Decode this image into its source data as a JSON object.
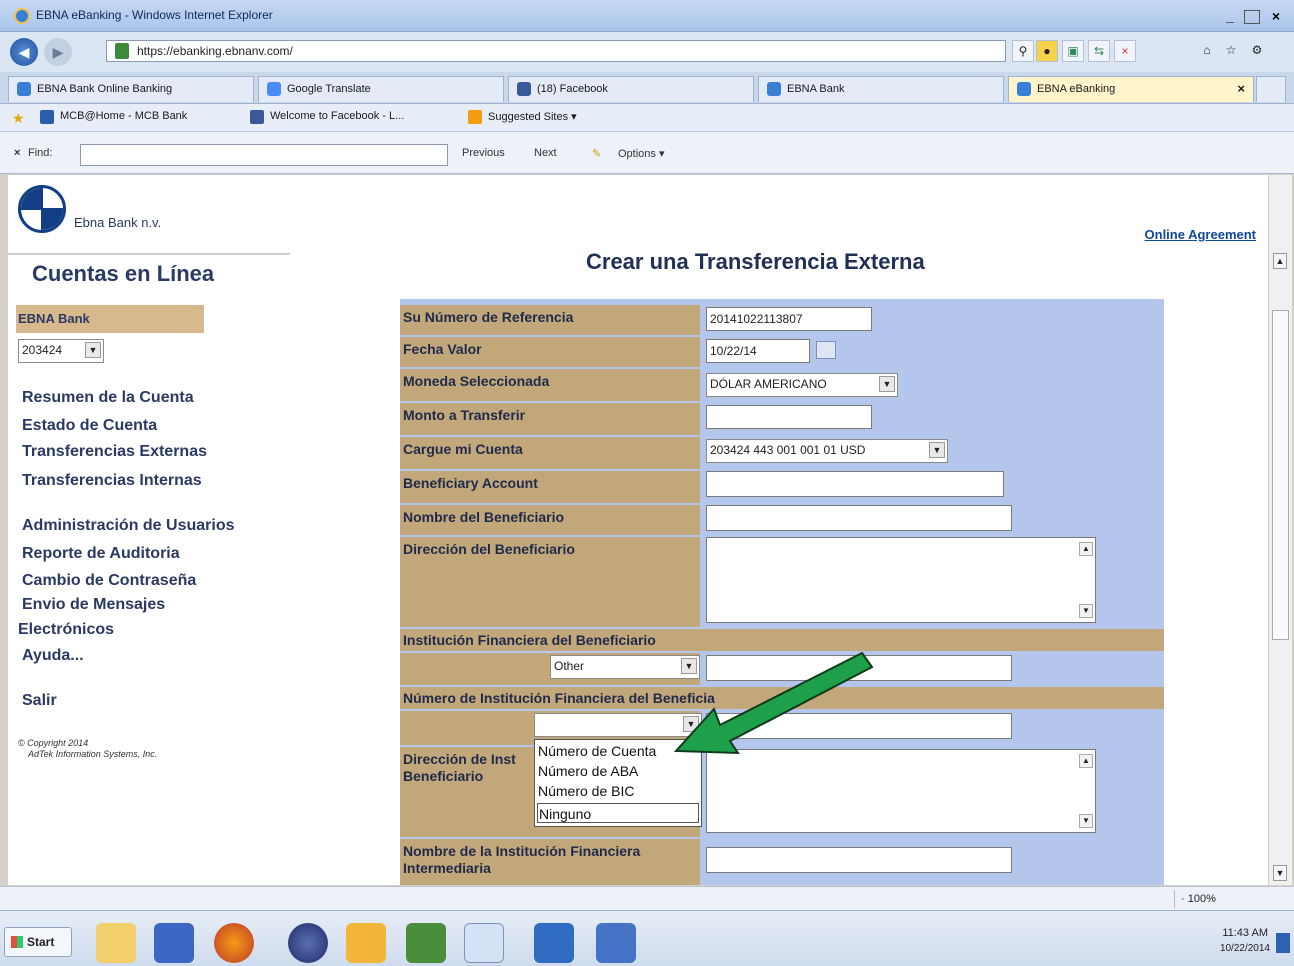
{
  "window": {
    "title": "EBNA eBanking - Windows Internet Explorer",
    "minimize": "_",
    "maximize": " ",
    "close": "×"
  },
  "address": {
    "url": "https://ebanking.ebnanv.com/"
  },
  "tabs": [
    {
      "label": "EBNA Bank Online Banking"
    },
    {
      "label": "Google Translate"
    },
    {
      "label": "(18) Facebook"
    },
    {
      "label": "EBNA Bank"
    },
    {
      "label": "EBNA eBanking",
      "close": "×"
    }
  ],
  "favorites": [
    {
      "label": "MCB@Home - MCB Bank"
    },
    {
      "label": "Welcome to Facebook - L..."
    },
    {
      "label": "Suggested Sites ▾"
    }
  ],
  "findbar": {
    "close": "×",
    "label": "Find:",
    "previous": "Previous",
    "next": "Next",
    "options": "Options ▾"
  },
  "header": {
    "bank_name": "Ebna Bank n.v.",
    "online_agreement": "Online Agreement"
  },
  "sidebar": {
    "title": "Cuentas en Línea",
    "bank_bar": "EBNA Bank",
    "account_select": "203424",
    "links": [
      "Resumen de la Cuenta",
      "Estado de Cuenta",
      "Transferencias Externas",
      "Transferencias Internas",
      "Administración de Usuarios",
      "Reporte de Auditoria",
      "Cambio de Contraseña",
      "Envio de Mensajes",
      "Electrónicos",
      "Ayuda...",
      "Salir"
    ],
    "copyright_line1": "© Copyright 2014",
    "copyright_line2": "AdTek Information Systems, Inc."
  },
  "form": {
    "heading": "Crear una Transferencia Externa",
    "labels": {
      "reference": "Su Número de Referencia",
      "value_date": "Fecha Valor",
      "currency": "Moneda Seleccionada",
      "amount": "Monto a Transferir",
      "debit_account": "Cargue mi Cuenta",
      "beneficiary_account": "Beneficiary Account",
      "beneficiary_name": "Nombre del Beneficiario",
      "beneficiary_address": "Dirección del Beneficiario",
      "fi_section": "Institución Financiera del Beneficiario",
      "fi_number": "Número de Institución Financiera del Beneficia",
      "fi_address_1": "Dirección de Inst",
      "fi_address_2": "Beneficiario",
      "intermediary_1": "Nombre de la Institución Financiera",
      "intermediary_2": "Intermediaria"
    },
    "values": {
      "reference": "20141022113807",
      "value_date": "10/22/14",
      "currency": "DÓLAR AMERICANO",
      "amount": "",
      "debit_account": "203424 443 001 001 01 USD",
      "beneficiary_account": "",
      "beneficiary_name": "",
      "fi_type": "Other",
      "fi_number_type": ""
    },
    "dropdown_options": [
      "Número de Cuenta",
      "Número de ABA",
      "Número de BIC",
      "Ninguno"
    ]
  },
  "statusbar": {
    "zoom": "· 100%"
  },
  "taskbar": {
    "start": "Start",
    "time": "11:43 AM",
    "date": "10/22/2014"
  },
  "colors": {
    "label_bg": "#c2a77b",
    "form_bg": "#b4c6ec",
    "arrow": "#1ea04a",
    "link": "#10479a"
  }
}
